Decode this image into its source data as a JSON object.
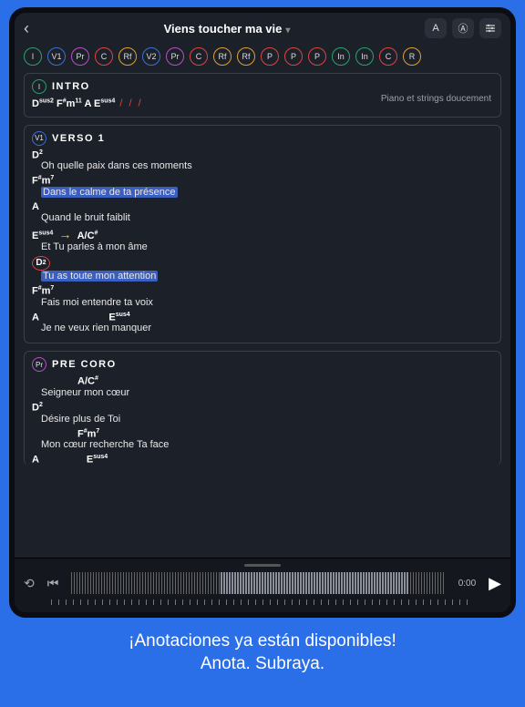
{
  "header": {
    "title": "Viens toucher ma vie",
    "btn_a": "A",
    "btn_o": "Ⓐ"
  },
  "chips": [
    {
      "t": "I",
      "c": "#2aa36b"
    },
    {
      "t": "V1",
      "c": "#3b6fd6"
    },
    {
      "t": "Pr",
      "c": "#b84fc4"
    },
    {
      "t": "C",
      "c": "#d44"
    },
    {
      "t": "Rf",
      "c": "#e0a030"
    },
    {
      "t": "V2",
      "c": "#3b6fd6"
    },
    {
      "t": "Pr",
      "c": "#b84fc4"
    },
    {
      "t": "C",
      "c": "#d44"
    },
    {
      "t": "Rf",
      "c": "#e0a030"
    },
    {
      "t": "Rf",
      "c": "#e0a030"
    },
    {
      "t": "P",
      "c": "#d44"
    },
    {
      "t": "P",
      "c": "#d44"
    },
    {
      "t": "P",
      "c": "#d44"
    },
    {
      "t": "In",
      "c": "#2aa36b"
    },
    {
      "t": "In",
      "c": "#2aa36b"
    },
    {
      "t": "C",
      "c": "#d44"
    },
    {
      "t": "R",
      "c": "#e0a030"
    }
  ],
  "intro": {
    "badge": "I",
    "title": "INTRO",
    "note": "Piano et strings doucement",
    "chords_html": "D<sup>sus2</sup> F<sup>#</sup>m<sup>11</sup> A E<sup>sus4</sup>",
    "slashes": " / / /"
  },
  "verso": {
    "badge": "V1",
    "title": "VERSO 1",
    "lines": [
      {
        "c": "D<sup>2</sup>",
        "l": "Oh quelle paix dans ces moments"
      },
      {
        "c": "F<sup>#</sup>m<sup>7</sup>",
        "l": "Dans le calme de ta présence",
        "hl": true
      },
      {
        "c": "A",
        "l": "Quand le bruit faiblit"
      }
    ],
    "arrow_line": {
      "c1": "E<sup>sus4</sup>",
      "c2": "A/C<sup>#</sup>",
      "l": "Et   Tu parles à mon   âme"
    },
    "circled": {
      "c": "D<sup>2</sup>",
      "l": "Tu as toute mon attention",
      "hl": true
    },
    "tail": [
      {
        "c": "F<sup>#</sup>m<sup>7</sup>",
        "l": "Fais  moi entendre ta voix"
      },
      {
        "c": "A",
        "c2": "E<sup>sus4</sup>",
        "l": "Je ne veux rien manquer"
      }
    ]
  },
  "precoro": {
    "badge": "Pr",
    "title": "PRE CORO",
    "lines": [
      {
        "c": "A/C<sup>#</sup>",
        "pre": "",
        "l": "Seigneur mon   cœur"
      },
      {
        "c": "D<sup>2</sup>",
        "l": "Désire plus de Toi"
      },
      {
        "c": "F<sup>#</sup>m<sup>7</sup>",
        "pre": "",
        "l": "Mon cœur  recherche Ta face"
      },
      {
        "c": "A",
        "c2": "E<sup>sus4</sup>",
        "l": ""
      }
    ]
  },
  "player": {
    "time": "0:00"
  },
  "promo": {
    "line1": "¡Anotaciones ya están disponibles!",
    "line2": "Anota. Subraya."
  }
}
